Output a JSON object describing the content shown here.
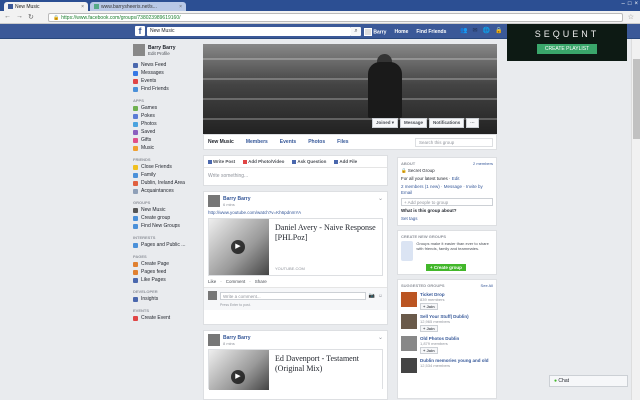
{
  "browser": {
    "tabs": [
      {
        "label": "New Music",
        "active": true
      },
      {
        "label": "www.barrysheeris.net/s...",
        "active": false
      }
    ],
    "url": "https://www.facebook.com/groups/738023989619160/"
  },
  "fb_header": {
    "search_value": "New Music",
    "user": "Barry",
    "nav_home": "Home",
    "nav_find_friends": "Find Friends"
  },
  "ad": {
    "brand": "SEQUENT",
    "cta": "CREATE PLAYLIST"
  },
  "left": {
    "profile_name": "Barry Barry",
    "edit_profile": "Edit Profile",
    "favorites": [
      "News Feed",
      "Messages",
      "Events",
      "Find Friends"
    ],
    "apps_title": "APPS",
    "apps": [
      "Games",
      "Pokes",
      "Photos",
      "Saved",
      "Gifts",
      "Music"
    ],
    "friends_title": "FRIENDS",
    "friends": [
      "Close Friends",
      "Family",
      "Dublin, Ireland Area",
      "Acquaintances"
    ],
    "groups_title": "GROUPS",
    "groups": [
      "New Music",
      "Create group",
      "Find New Groups"
    ],
    "interests_title": "INTERESTS",
    "interests": [
      "Pages and Public ..."
    ],
    "pages_title": "PAGES",
    "pages": [
      "Create Page",
      "Pages feed",
      "Like Pages"
    ],
    "developer_title": "DEVELOPER",
    "developer": [
      "Insights"
    ],
    "events_title": "EVENTS",
    "events": [
      "Create Event"
    ]
  },
  "cover": {
    "joined": "Joined ▾",
    "message": "Message",
    "notifications": "Notifications",
    "more": "···"
  },
  "group_tabs": [
    "New Music",
    "Members",
    "Events",
    "Photos",
    "Files"
  ],
  "group_search_placeholder": "Search this group",
  "composer": {
    "tabs": [
      "Write Post",
      "Add Photo/Video",
      "Ask Question",
      "Add File"
    ],
    "placeholder": "Write something..."
  },
  "posts": [
    {
      "author": "Barry Barry",
      "time": "6 mins",
      "link": "http://www.youtube.com/watch?v=Kh6pdnmYA",
      "video_title": "Daniel Avery - Naive Response [PHLPoz]",
      "source": "YOUTUBE.COM",
      "actions": [
        "Like",
        "Comment",
        "Share"
      ],
      "comment_placeholder": "Write a comment...",
      "press_enter": "Press Enter to post."
    },
    {
      "author": "Barry Barry",
      "time": "8 mins",
      "video_title": "Ed Davenport - Testament (Original Mix)"
    }
  ],
  "right": {
    "about_title": "ABOUT",
    "members_count": "2 members",
    "secret": "Secret Group",
    "desc": "For all your latest tunes",
    "edit": "Edit",
    "members_line": "2 members (1 new) · Message · Invite by Email",
    "add_people_placeholder": "+ Add people to group",
    "what_title": "What is this group about?",
    "set_tags": "Set tags",
    "create_title": "CREATE NEW GROUPS",
    "create_text": "Groups make it easier than ever to share with friends, family and teammates.",
    "create_btn": "+ Create group",
    "suggested_title": "SUGGESTED GROUPS",
    "see_all": "See All",
    "suggested": [
      {
        "name": "Ticket Drop",
        "members": "839 members",
        "join": "+ Join"
      },
      {
        "name": "Sell Your Stuff| Dublin)",
        "members": "12,965 members",
        "join": "+ Join"
      },
      {
        "name": "Old Photos Dublin",
        "members": "1,879 members",
        "join": "+ Join"
      },
      {
        "name": "Dublin memories young and old",
        "members": "12,534 members",
        "join": "+ Join"
      }
    ]
  },
  "chat": {
    "label": "Chat"
  }
}
